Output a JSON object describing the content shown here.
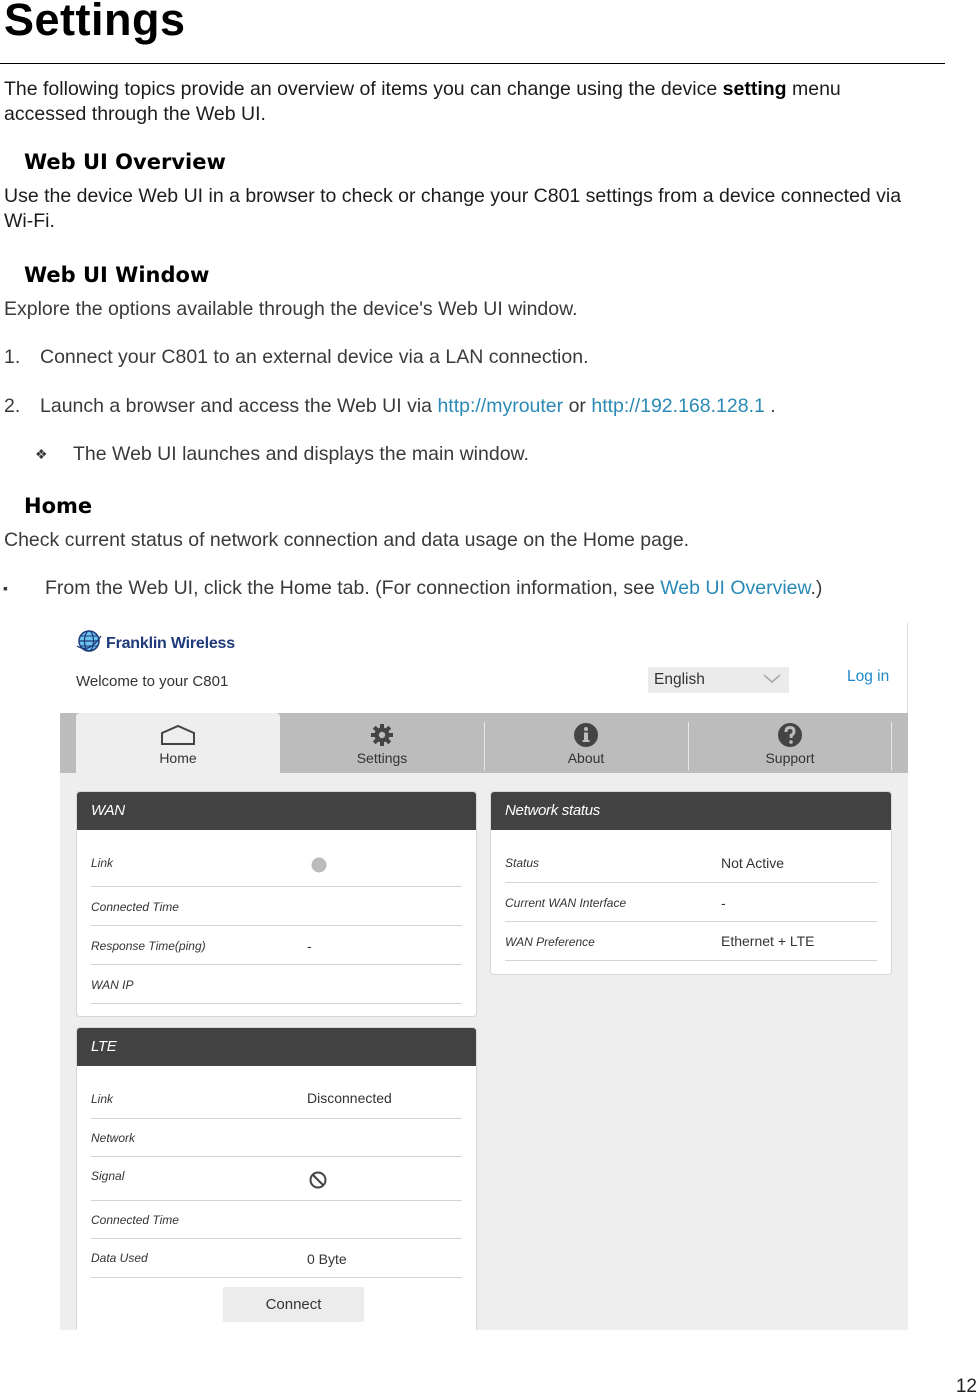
{
  "page": {
    "title": "Settings",
    "intro_pre": "The following topics provide an overview of items you can change using the device ",
    "intro_bold": "setting",
    "intro_post": " menu",
    "intro_line2": "accessed through the Web UI.",
    "page_number": "12"
  },
  "sections": {
    "overview": {
      "heading": "Web UI Overview",
      "line1": "Use the device Web UI in a browser to check or change your C801 settings from a device connected via",
      "line2": "Wi-Fi."
    },
    "window": {
      "heading": "Web UI Window",
      "body": "Explore the options available through the device's Web UI window.",
      "step1_num": "1.",
      "step1": "Connect your C801 to an external device via a LAN connection.",
      "step2_num": "2.",
      "step2_pre": "Launch a browser and access the Web UI via ",
      "step2_link1": "http://myrouter",
      "step2_mid": " or ",
      "step2_link2": "http://192.168.128.1",
      "step2_post": " .",
      "result_bullet": "❖",
      "result": "The Web UI launches and displays the main window."
    },
    "home": {
      "heading": "Home",
      "body": "Check current status of network connection and data usage on the Home page.",
      "bullet": "▪",
      "step_pre": "From the Web UI, click the Home tab. (For connection information, see ",
      "step_link": "Web UI Overview",
      "step_post": ".)"
    }
  },
  "webui": {
    "brand": "Franklin Wireless",
    "welcome": "Welcome to your C801",
    "language": {
      "selected": "English"
    },
    "login": "Log in",
    "colors": {
      "accent_link": "#1e88c8",
      "panel_header": "#424242",
      "nav_bg": "#bcbcbc"
    },
    "tabs": [
      {
        "label": "Home",
        "icon": "home-icon",
        "active": true
      },
      {
        "label": "Settings",
        "icon": "gear-icon",
        "active": false
      },
      {
        "label": "About",
        "icon": "info-icon",
        "active": false
      },
      {
        "label": "Support",
        "icon": "help-icon",
        "active": false
      }
    ],
    "wan": {
      "title": "WAN",
      "rows": [
        {
          "label": "Link",
          "value": "",
          "status": "inactive-dot"
        },
        {
          "label": "Connected Time",
          "value": ""
        },
        {
          "label": "Response Time(ping)",
          "value": "-"
        },
        {
          "label": "WAN IP",
          "value": ""
        }
      ]
    },
    "network_status": {
      "title": "Network status",
      "rows": [
        {
          "label": "Status",
          "value": "Not Active"
        },
        {
          "label": "Current WAN Interface",
          "value": "-"
        },
        {
          "label": "WAN Preference",
          "value": "Ethernet + LTE"
        }
      ]
    },
    "lte": {
      "title": "LTE",
      "rows": [
        {
          "label": "Link",
          "value": "Disconnected"
        },
        {
          "label": "Network",
          "value": ""
        },
        {
          "label": "Signal",
          "value": "",
          "status": "no-signal"
        },
        {
          "label": "Connected Time",
          "value": ""
        },
        {
          "label": "Data Used",
          "value": "0 Byte"
        }
      ],
      "connect_label": "Connect"
    }
  }
}
